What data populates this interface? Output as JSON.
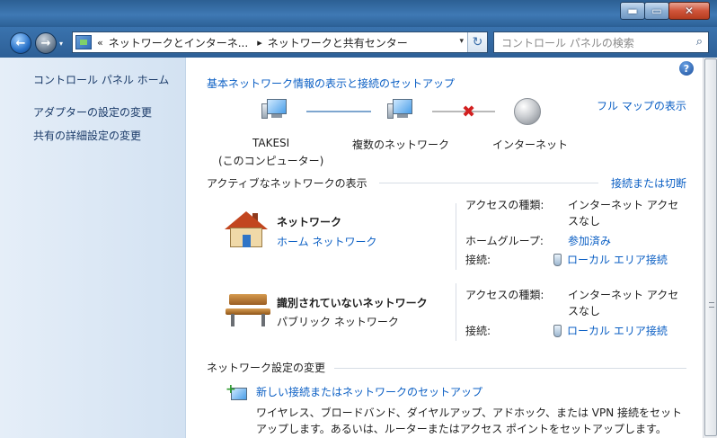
{
  "window": {
    "min_glyph": "▬",
    "max_glyph": "▭",
    "close_glyph": "✕"
  },
  "address": {
    "back_glyph": "←",
    "forward_glyph": "→",
    "overflow": "«",
    "crumb1": "ネットワークとインターネ...",
    "crumb2": "ネットワークと共有センター",
    "sep": "▸",
    "dropdown_glyph": "▾",
    "refresh_glyph": "↻"
  },
  "search": {
    "placeholder": "コントロール パネルの検索",
    "icon_glyph": "⌕"
  },
  "sidebar": {
    "home": "コントロール パネル ホーム",
    "items": [
      "アダプターの設定の変更",
      "共有の詳細設定の変更"
    ]
  },
  "main": {
    "help_glyph": "?",
    "heading": "基本ネットワーク情報の表示と接続のセットアップ",
    "full_map": "フル マップの表示",
    "map": {
      "computer_name": "TAKESI",
      "computer_sub": "(このコンピューター)",
      "multi_network": "複数のネットワーク",
      "internet": "インターネット",
      "broken_glyph": "✖"
    },
    "active_section": "アクティブなネットワークの表示",
    "connect_disconnect": "接続または切断",
    "networks": [
      {
        "name": "ネットワーク",
        "type": "ホーム ネットワーク",
        "access_label": "アクセスの種類:",
        "access_value_1": "インターネット アクセ",
        "access_value_2": "スなし",
        "homegroup_label": "ホームグループ:",
        "homegroup_value": "参加済み",
        "connection_label": "接続:",
        "connection_value": "ローカル エリア接続"
      },
      {
        "name": "識別されていないネットワーク",
        "type": "パブリック ネットワーク",
        "access_label": "アクセスの種類:",
        "access_value_1": "インターネット アクセ",
        "access_value_2": "スなし",
        "connection_label": "接続:",
        "connection_value": "ローカル エリア接続"
      }
    ],
    "change_section": "ネットワーク設定の変更",
    "setup_link": "新しい接続またはネットワークのセットアップ",
    "setup_desc_1": "ワイヤレス、ブロードバンド、ダイヤルアップ、アドホック、または VPN 接続をセット",
    "setup_desc_2": "アップします。あるいは、ルーターまたはアクセス ポイントをセットアップします。"
  },
  "colors": {
    "link": "#0b5fc4",
    "sidebar_bg": "#dbe7f4",
    "titlebar": "#3a73ae"
  }
}
